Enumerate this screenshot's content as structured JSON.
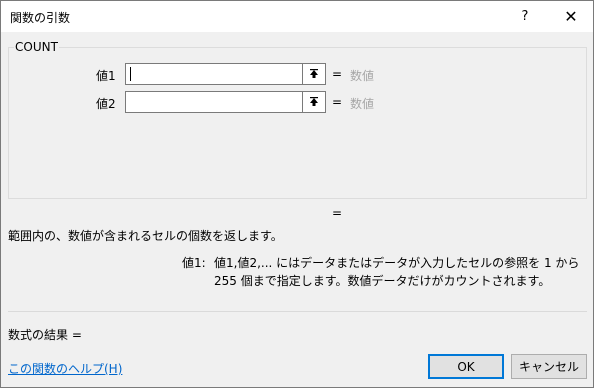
{
  "window": {
    "title": "関数の引数",
    "help_glyph": "?",
    "close_glyph": "✕"
  },
  "function": {
    "name": "COUNT",
    "args": [
      {
        "label": "値1",
        "value": "",
        "result": "数値"
      },
      {
        "label": "値2",
        "value": "",
        "result": "数値"
      }
    ],
    "equals": "=",
    "result_equals": "="
  },
  "description": {
    "summary": "範囲内の、数値が含まれるセルの個数を返します。",
    "arg_name": "値1:",
    "arg_text": "値1,値2,... にはデータまたはデータが入力したセルの参照を 1 から 255 個まで指定します。数値データだけがカウントされます。"
  },
  "formula_result": "数式の結果 =",
  "help_link": "この関数のヘルプ(H)",
  "buttons": {
    "ok": "OK",
    "cancel": "キャンセル"
  }
}
